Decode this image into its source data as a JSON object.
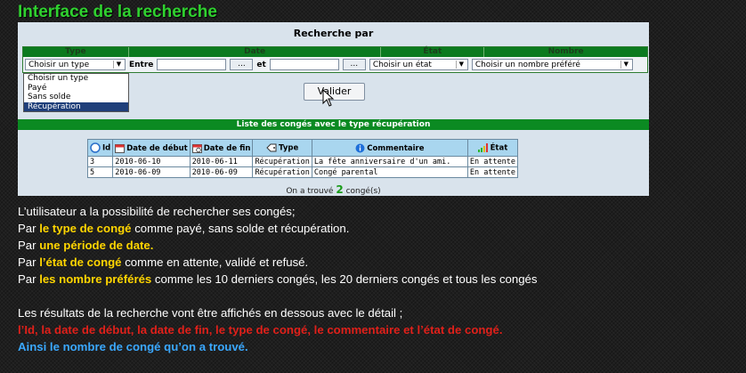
{
  "slide_title": "Interface de la recherche",
  "search_panel": {
    "title": "Recherche par",
    "headers": [
      "Type",
      "Date",
      "État",
      "Nombre"
    ],
    "type_select": "Choisir un type",
    "entre_label": "Entre",
    "et_label": "et",
    "dots_label": "...",
    "etat_select": "Choisir un état",
    "nombre_select": "Choisir un nombre préféré",
    "dropdown_options": [
      "Choisir un type",
      "Payé",
      "Sans solde",
      "Récupération"
    ],
    "dropdown_selected": "Récupération",
    "validate_label": "Valider"
  },
  "results": {
    "banner": "Liste des congés avec le type récupération",
    "columns": [
      "Id",
      "Date de début",
      "Date de fin",
      "Type",
      "Commentaire",
      "État"
    ],
    "rows": [
      [
        "3",
        "2010-06-10",
        "2010-06-11",
        "Récupération",
        "La fête anniversaire d'un ami.",
        "En attente"
      ],
      [
        "5",
        "2010-06-09",
        "2010-06-09",
        "Récupération",
        "Congé parental",
        "En attente"
      ]
    ],
    "found_prefix": "On a trouvé",
    "found_count": "2",
    "found_suffix": "congé(s)"
  },
  "description": {
    "line1": "L’utilisateur  a la possibilité  de rechercher  ses congés;",
    "line2_pre": "Par ",
    "line2_hl": "le type de congé",
    "line2_post": " comme  payé, sans  solde et récupération.",
    "line3_pre": "Par ",
    "line3_hl": "une période  de date.",
    "line4_pre": "Par ",
    "line4_hl": "l’état de congé",
    "line4_post": " comme  en attente,  validé  et refusé.",
    "line5_pre": "Par ",
    "line5_hl": "les nombre préférés",
    "line5_post": "  comme  les  10 derniers congés, les 20 derniers congés et tous les congés",
    "line6": "Les résultats  de  la recherche  vont  être affichés  en dessous  avec  le détail ;",
    "line7": " l’Id, la date de début, la date  de fin, le type de congé,  le commentaire et l’état de congé.",
    "line8": "Ainsi  le nombre de congé qu’on  a trouvé."
  },
  "colors": {
    "title_green": "#2fd12f",
    "highlight_yellow": "#ffd500",
    "highlight_red": "#e0201a",
    "highlight_blue": "#3aa8ff",
    "banner_green": "#0b8a22"
  }
}
